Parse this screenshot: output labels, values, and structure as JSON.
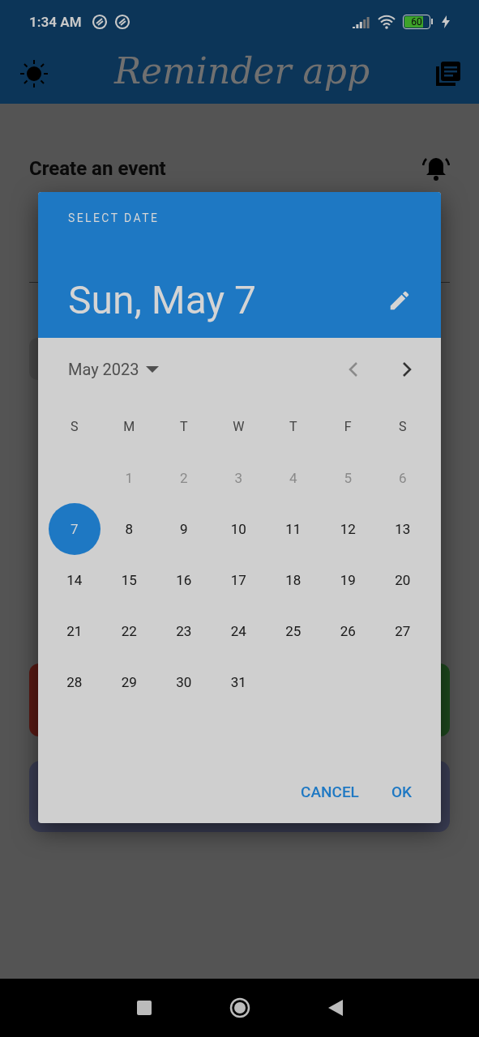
{
  "status_bar": {
    "time": "1:34 AM",
    "battery": "60"
  },
  "app_bar": {
    "title": "Reminder app"
  },
  "page": {
    "heading": "Create an event"
  },
  "dialog": {
    "label": "SELECT DATE",
    "date": "Sun, May 7",
    "month": "May 2023",
    "weekdays": [
      "S",
      "M",
      "T",
      "W",
      "T",
      "F",
      "S"
    ],
    "days": [
      {
        "label": "1",
        "disabled": true,
        "selected": false
      },
      {
        "label": "2",
        "disabled": true,
        "selected": false
      },
      {
        "label": "3",
        "disabled": true,
        "selected": false
      },
      {
        "label": "4",
        "disabled": true,
        "selected": false
      },
      {
        "label": "5",
        "disabled": true,
        "selected": false
      },
      {
        "label": "6",
        "disabled": true,
        "selected": false
      },
      {
        "label": "7",
        "disabled": false,
        "selected": true
      },
      {
        "label": "8",
        "disabled": false,
        "selected": false
      },
      {
        "label": "9",
        "disabled": false,
        "selected": false
      },
      {
        "label": "10",
        "disabled": false,
        "selected": false
      },
      {
        "label": "11",
        "disabled": false,
        "selected": false
      },
      {
        "label": "12",
        "disabled": false,
        "selected": false
      },
      {
        "label": "13",
        "disabled": false,
        "selected": false
      },
      {
        "label": "14",
        "disabled": false,
        "selected": false
      },
      {
        "label": "15",
        "disabled": false,
        "selected": false
      },
      {
        "label": "16",
        "disabled": false,
        "selected": false
      },
      {
        "label": "17",
        "disabled": false,
        "selected": false
      },
      {
        "label": "18",
        "disabled": false,
        "selected": false
      },
      {
        "label": "19",
        "disabled": false,
        "selected": false
      },
      {
        "label": "20",
        "disabled": false,
        "selected": false
      },
      {
        "label": "21",
        "disabled": false,
        "selected": false
      },
      {
        "label": "22",
        "disabled": false,
        "selected": false
      },
      {
        "label": "23",
        "disabled": false,
        "selected": false
      },
      {
        "label": "24",
        "disabled": false,
        "selected": false
      },
      {
        "label": "25",
        "disabled": false,
        "selected": false
      },
      {
        "label": "26",
        "disabled": false,
        "selected": false
      },
      {
        "label": "27",
        "disabled": false,
        "selected": false
      },
      {
        "label": "28",
        "disabled": false,
        "selected": false
      },
      {
        "label": "29",
        "disabled": false,
        "selected": false
      },
      {
        "label": "30",
        "disabled": false,
        "selected": false
      },
      {
        "label": "31",
        "disabled": false,
        "selected": false
      }
    ],
    "buttons": [
      "CANCEL",
      "OK"
    ]
  }
}
